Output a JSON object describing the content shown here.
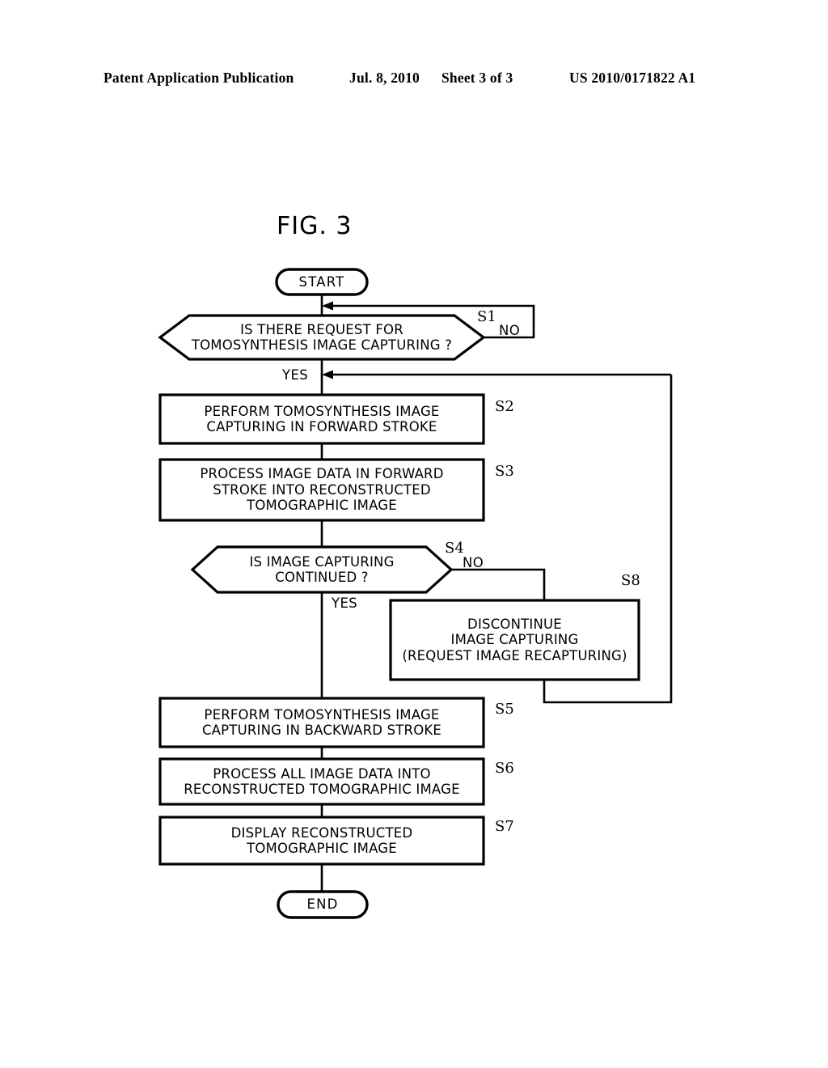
{
  "header": {
    "publication": "Patent Application Publication",
    "date": "Jul. 8, 2010",
    "sheet": "Sheet 3 of 3",
    "number": "US 2010/0171822 A1"
  },
  "figure": {
    "title": "FIG. 3"
  },
  "flowchart": {
    "start": {
      "label": "START"
    },
    "end": {
      "label": "END"
    },
    "nodes": [
      {
        "id": "S1",
        "step": "S1",
        "type": "decision",
        "text": "IS THERE REQUEST FOR\nTOMOSYNTHESIS IMAGE CAPTURING ?",
        "yes_label": "YES",
        "no_label": "NO"
      },
      {
        "id": "S2",
        "step": "S2",
        "type": "process",
        "text": "PERFORM TOMOSYNTHESIS IMAGE\nCAPTURING IN FORWARD STROKE"
      },
      {
        "id": "S3",
        "step": "S3",
        "type": "process",
        "text": "PROCESS IMAGE DATA IN FORWARD\nSTROKE INTO RECONSTRUCTED\nTOMOGRAPHIC IMAGE"
      },
      {
        "id": "S4",
        "step": "S4",
        "type": "decision",
        "text": "IS IMAGE CAPTURING\nCONTINUED ?",
        "yes_label": "YES",
        "no_label": "NO"
      },
      {
        "id": "S8",
        "step": "S8",
        "type": "process",
        "text": "DISCONTINUE\nIMAGE CAPTURING\n(REQUEST IMAGE RECAPTURING)"
      },
      {
        "id": "S5",
        "step": "S5",
        "type": "process",
        "text": "PERFORM TOMOSYNTHESIS IMAGE\nCAPTURING IN BACKWARD STROKE"
      },
      {
        "id": "S6",
        "step": "S6",
        "type": "process",
        "text": "PROCESS ALL IMAGE DATA INTO\nRECONSTRUCTED TOMOGRAPHIC IMAGE"
      },
      {
        "id": "S7",
        "step": "S7",
        "type": "process",
        "text": "DISPLAY RECONSTRUCTED\nTOMOGRAPHIC IMAGE"
      }
    ]
  },
  "colors": {
    "ink": "#000000",
    "paper": "#ffffff"
  }
}
